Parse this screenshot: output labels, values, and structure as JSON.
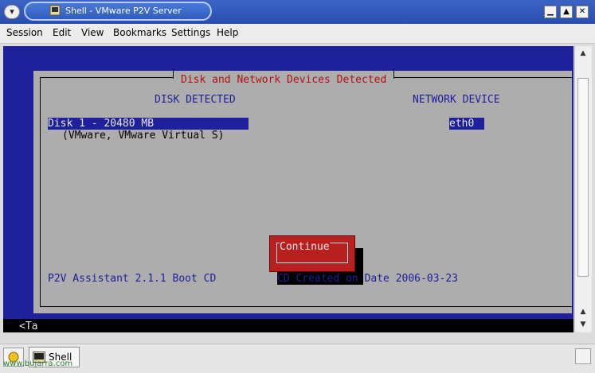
{
  "window": {
    "title": "Shell - VMware P2V Server",
    "menu_button_icon": "chevron-down-icon",
    "controls": [
      "minimize-icon",
      "maximize-icon",
      "close-icon"
    ]
  },
  "menubar": {
    "items": [
      "Session",
      "Edit",
      "View",
      "Bookmarks",
      "Settings",
      "Help"
    ]
  },
  "dialog": {
    "title": "Disk and Network Devices Detected",
    "disk_header": "DISK DETECTED",
    "network_header": "NETWORK DEVICE",
    "disk_selected": "Disk 1 - 20480 MB",
    "disk_detail": "(VMware, VMware Virtual S)",
    "network_selected": "eth0",
    "continue_label": "Continue",
    "footer_left": "P2V Assistant 2.1.1 Boot CD",
    "footer_right": "CD Created on Date 2006-03-23"
  },
  "terminal": {
    "bottom_hint": "<Ta"
  },
  "taskbar": {
    "task_label": "Shell",
    "watermark_site": "www.bujarra.com"
  },
  "colors": {
    "terminal_bg": "#1f219c",
    "dialog_bg": "#adadad",
    "title_red": "#b01010",
    "button_red": "#b82020"
  }
}
